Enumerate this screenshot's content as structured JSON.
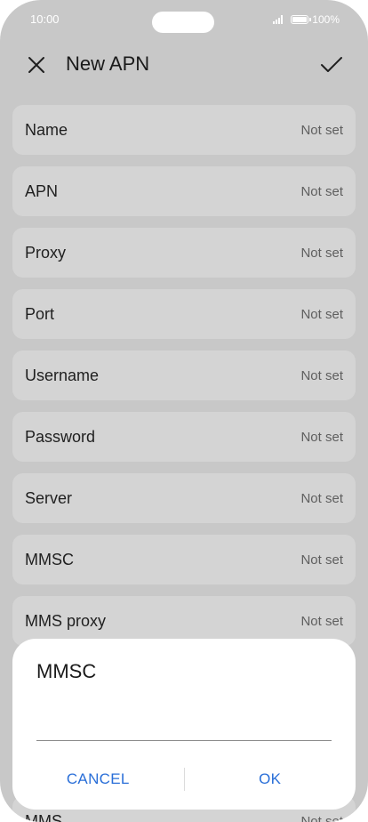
{
  "status_bar": {
    "time": "10:00",
    "battery": "100%"
  },
  "header": {
    "title": "New APN",
    "close_icon": "close-icon",
    "confirm_icon": "check-icon"
  },
  "fields": [
    {
      "label": "Name",
      "value": "Not set"
    },
    {
      "label": "APN",
      "value": "Not set"
    },
    {
      "label": "Proxy",
      "value": "Not set"
    },
    {
      "label": "Port",
      "value": "Not set"
    },
    {
      "label": "Username",
      "value": "Not set"
    },
    {
      "label": "Password",
      "value": "Not set"
    },
    {
      "label": "Server",
      "value": "Not set"
    },
    {
      "label": "MMSC",
      "value": "Not set"
    },
    {
      "label": "MMS proxy",
      "value": "Not set"
    },
    {
      "label": "MMS",
      "value": "Not set"
    }
  ],
  "dialog": {
    "title": "MMSC",
    "input_value": "",
    "cancel_label": "CANCEL",
    "ok_label": "OK"
  },
  "colors": {
    "accent": "#2a6fd8",
    "scrim_background": "#c8c8c8",
    "row_background": "#d4d4d4"
  }
}
